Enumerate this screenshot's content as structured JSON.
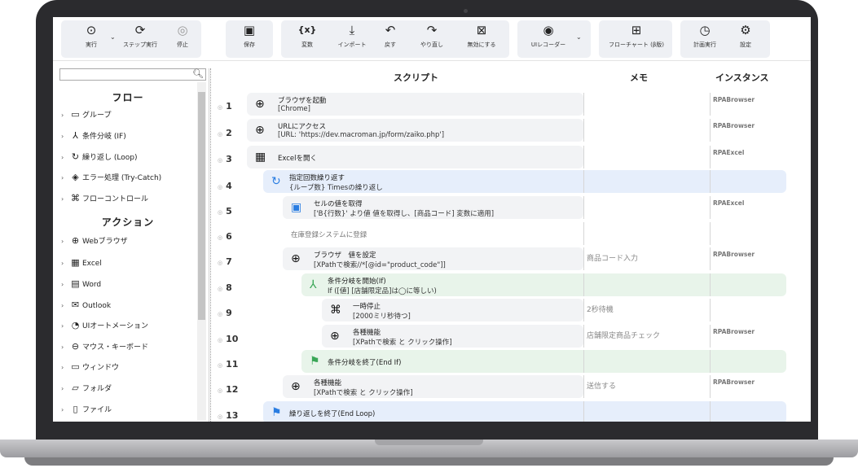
{
  "toolbar": {
    "run": "実行",
    "step": "ステップ実行",
    "stop": "停止",
    "save": "保存",
    "variables": "変数",
    "import": "インポート",
    "undo": "戻す",
    "redo": "やり直し",
    "disable": "無効にする",
    "ui_recorder": "UIレコーダー",
    "flowchart": "フローチャート (β版)",
    "schedule": "計画実行",
    "settings": "設定"
  },
  "left": {
    "search_value": "",
    "flow_heading": "フロー",
    "flow_items": [
      {
        "label": "グループ",
        "icon": "group-icon"
      },
      {
        "label": "条件分岐 (IF)",
        "icon": "branch-icon"
      },
      {
        "label": "繰り返し (Loop)",
        "icon": "loop-icon"
      },
      {
        "label": "エラー処理 (Try-Catch)",
        "icon": "error-icon"
      },
      {
        "label": "フローコントロール",
        "icon": "command-icon"
      }
    ],
    "action_heading": "アクション",
    "action_items": [
      {
        "label": "Webブラウザ",
        "icon": "globe-icon"
      },
      {
        "label": "Excel",
        "icon": "excel-icon"
      },
      {
        "label": "Word",
        "icon": "word-icon"
      },
      {
        "label": "Outlook",
        "icon": "outlook-icon"
      },
      {
        "label": "UIオートメーション",
        "icon": "ui-automation-icon"
      },
      {
        "label": "マウス・キーボード",
        "icon": "mouse-icon"
      },
      {
        "label": "ウィンドウ",
        "icon": "window-icon"
      },
      {
        "label": "フォルダ",
        "icon": "folder-icon"
      },
      {
        "label": "ファイル",
        "icon": "file-icon"
      }
    ]
  },
  "table": {
    "col_script": "スクリプト",
    "col_memo": "メモ",
    "col_instance": "インスタンス",
    "rows": [
      {
        "num": "1",
        "t1": "ブラウザを起動",
        "t2": "[Chrome]",
        "memo": "",
        "inst": "RPABrowser"
      },
      {
        "num": "2",
        "t1": "URLにアクセス",
        "t2": "[URL: 'https://dev.macroman.jp/form/zaiko.php']",
        "memo": "",
        "inst": "RPABrowser"
      },
      {
        "num": "3",
        "t1": "Excelを開く",
        "t2": "",
        "memo": "",
        "inst": "RPAExcel"
      },
      {
        "num": "4",
        "t1": "指定回数繰り返す",
        "t2": "{ループ数} Timesの繰り返し",
        "memo": "",
        "inst": ""
      },
      {
        "num": "5",
        "t1": "セルの値を取得",
        "t2": "['B{行数}' より値 値を取得し、[商品コード] 変数に適用]",
        "memo": "",
        "inst": "RPAExcel"
      },
      {
        "num": "6",
        "t1": "在庫登録システムに登録",
        "t2": "",
        "memo": "",
        "inst": ""
      },
      {
        "num": "7",
        "t1": "ブラウザ　値を設定",
        "t2": "[XPathで検索//*[@id=\"product_code\"]]",
        "memo": "商品コード入力",
        "inst": "RPABrowser"
      },
      {
        "num": "8",
        "t1": "条件分岐を開始(If)",
        "t2": "If ([値] [店舗限定品]は◯に等しい)",
        "memo": "",
        "inst": ""
      },
      {
        "num": "9",
        "t1": "一時停止",
        "t2": "[2000ミリ秒待つ]",
        "memo": "2秒待機",
        "inst": ""
      },
      {
        "num": "10",
        "t1": "各種機能",
        "t2": "[XPathで検索 と クリック操作]",
        "memo": "店舗限定商品チェック",
        "inst": "RPABrowser"
      },
      {
        "num": "11",
        "t1": "条件分岐を終了(End If)",
        "t2": "",
        "memo": "",
        "inst": ""
      },
      {
        "num": "12",
        "t1": "各種機能",
        "t2": "[XPathで検索 と クリック操作]",
        "memo": "送信する",
        "inst": "RPABrowser"
      },
      {
        "num": "13",
        "t1": "繰り返しを終了(End Loop)",
        "t2": "",
        "memo": "",
        "inst": ""
      }
    ]
  }
}
